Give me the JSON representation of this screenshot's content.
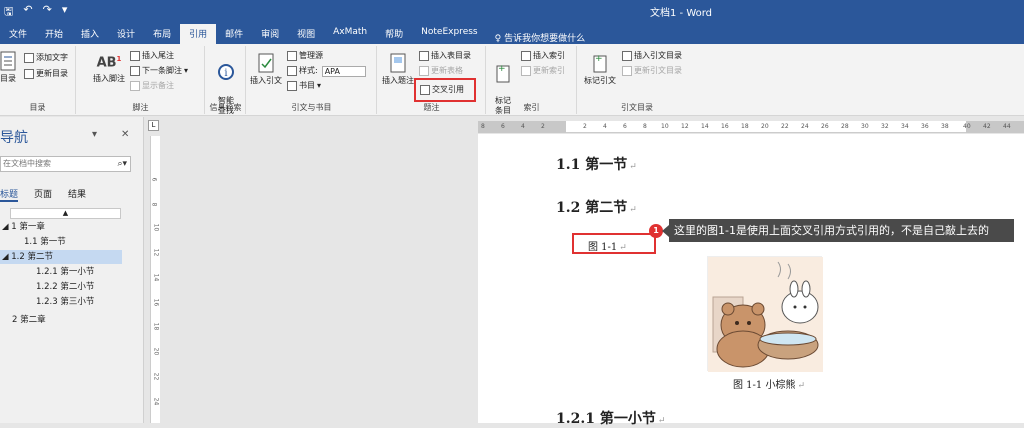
{
  "title_bar": {
    "doc_title": "文档1 - Word",
    "qat": [
      "save-icon",
      "undo-icon",
      "redo-icon",
      "customize-icon"
    ]
  },
  "tabs": [
    "文件",
    "开始",
    "插入",
    "设计",
    "布局",
    "引用",
    "邮件",
    "审阅",
    "视图",
    "AxMath",
    "帮助",
    "NoteExpress"
  ],
  "active_tab": "引用",
  "tell_me": "告诉我你想要做什么",
  "ribbon": {
    "toc": {
      "big": "目录",
      "add_text": "添加文字",
      "update_toc": "更新目录",
      "label": "目录"
    },
    "footnotes": {
      "insert_footnote": "插入脚注",
      "insert_endnote": "插入尾注",
      "next_footnote": "下一条脚注",
      "show_notes": "显示备注",
      "label": "脚注"
    },
    "research": {
      "smart_lookup": "智能\n查找",
      "label": "信息检索"
    },
    "citations": {
      "insert_citation": "插入引文",
      "manage_sources": "管理源",
      "style_label": "样式:",
      "style_value": "APA",
      "bibliography": "书目",
      "label": "引文与书目"
    },
    "captions": {
      "insert_caption": "插入题注",
      "insert_table_of_figures": "插入表目录",
      "update_table": "更新表格",
      "cross_reference": "交叉引用",
      "label": "题注"
    },
    "index": {
      "mark_entry": "标记\n条目",
      "insert_index": "插入索引",
      "update_index": "更新索引",
      "label": "索引"
    },
    "authorities": {
      "mark_citation": "标记引文",
      "insert_toa": "插入引文目录",
      "update_toa": "更新引文目录",
      "label": "引文目录"
    }
  },
  "nav": {
    "title": "导航",
    "search_placeholder": "在文档中搜索",
    "tabs": [
      "标题",
      "页面",
      "结果"
    ],
    "active_tab": "标题",
    "tree": [
      {
        "label": "1 第一章",
        "level": 0,
        "expanded": true
      },
      {
        "label": "1.1 第一节",
        "level": 1
      },
      {
        "label": "1.2 第二节",
        "level": 1,
        "expanded": true,
        "selected": true
      },
      {
        "label": "1.2.1 第一小节",
        "level": 2
      },
      {
        "label": "1.2.2 第二小节",
        "level": 2
      },
      {
        "label": "1.2.3 第三小节",
        "level": 2
      },
      {
        "label": "2 第二章",
        "level": 0
      }
    ]
  },
  "ruler": {
    "h_ticks": [
      "8",
      "6",
      "4",
      "2",
      "2",
      "4",
      "6",
      "8",
      "10",
      "12",
      "14",
      "16",
      "18",
      "20",
      "22",
      "24",
      "26",
      "28",
      "30",
      "32",
      "34",
      "36",
      "38",
      "40",
      "42",
      "44"
    ],
    "v_ticks": [
      "6",
      "8",
      "10",
      "12",
      "14",
      "16",
      "18",
      "20",
      "22",
      "24"
    ]
  },
  "document": {
    "heading_1_1": "1.1 第一节",
    "heading_1_2": "1.2 第二节",
    "cross_ref_text": "图 1-1",
    "badge": "1",
    "tooltip": "这里的图1-1是使用上面交叉引用方式引用的，不是自己敲上去的",
    "caption": "图 1-1 小棕熊",
    "heading_1_2_1": "1.2.1 第一小节"
  }
}
